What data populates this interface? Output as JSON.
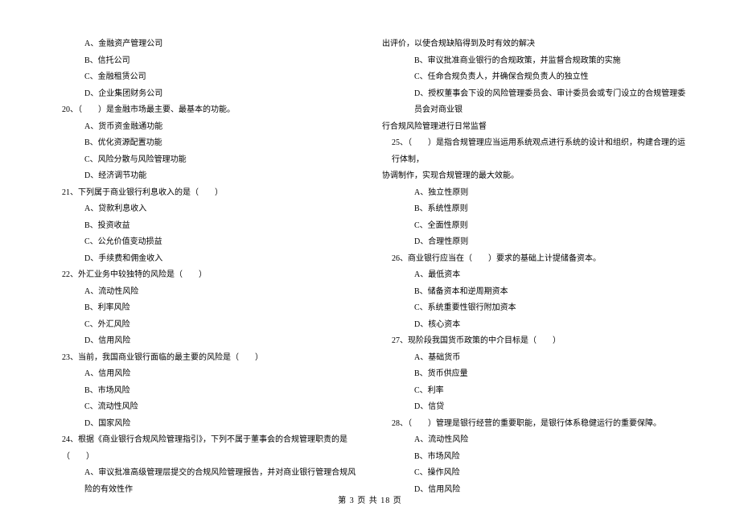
{
  "left": {
    "opts_pre": [
      "A、金融资产管理公司",
      "B、信托公司",
      "C、金融租赁公司",
      "D、企业集团财务公司"
    ],
    "q20": "20、（　　）是金融市场最主要、最基本的功能。",
    "q20_opts": [
      "A、货币资金融通功能",
      "B、优化资源配置功能",
      "C、风险分散与风险管理功能",
      "D、经济调节功能"
    ],
    "q21": "21、下列属于商业银行利息收入的是（　　）",
    "q21_opts": [
      "A、贷款利息收入",
      "B、投资收益",
      "C、公允价值变动损益",
      "D、手续费和佣金收入"
    ],
    "q22": "22、外汇业务中较独特的风险是（　　）",
    "q22_opts": [
      "A、流动性风险",
      "B、利率风险",
      "C、外汇风险",
      "D、信用风险"
    ],
    "q23": "23、当前，我国商业银行面临的最主要的风险是（　　）",
    "q23_opts": [
      "A、信用风险",
      "B、市场风险",
      "C、流动性风险",
      "D、国家风险"
    ],
    "q24": "24、根据《商业银行合规风险管理指引》，下列不属于董事会的合规管理职责的是（　　）",
    "q24_opts_partial": [
      "A、审议批准高级管理层提交的合规风险管理报告，并对商业银行管理合规风险的有效性作"
    ]
  },
  "right": {
    "cont1": "出评价，以使合规缺陷得到及时有效的解决",
    "q24_rest": [
      "B、审议批准商业银行的合规政策，并监督合规政策的实施",
      "C、任命合规负责人，并确保合规负责人的独立性",
      "D、授权董事会下设的风险管理委员会、审计委员会或专门设立的合规管理委员会对商业银"
    ],
    "cont2": "行合规风险管理进行日常监督",
    "q25_a": "25、（　　）是指合规管理应当运用系统观点进行系统的设计和组织，构建合理的运行体制，",
    "q25_b": "协调制作，实现合规管理的最大效能。",
    "q25_opts": [
      "A、独立性原则",
      "B、系统性原则",
      "C、全面性原则",
      "D、合理性原则"
    ],
    "q26": "26、商业银行应当在（　　）要求的基础上计提储备资本。",
    "q26_opts": [
      "A、最低资本",
      "B、储备资本和逆周期资本",
      "C、系统重要性银行附加资本",
      "D、核心资本"
    ],
    "q27": "27、现阶段我国货币政策的中介目标是（　　）",
    "q27_opts": [
      "A、基础货币",
      "B、货币供应量",
      "C、利率",
      "D、信贷"
    ],
    "q28": "28、（　　）管理是银行经营的重要职能，是银行体系稳健运行的重要保障。",
    "q28_opts": [
      "A、流动性风险",
      "B、市场风险",
      "C、操作风险",
      "D、信用风险"
    ]
  },
  "footer": "第 3 页 共 18 页"
}
